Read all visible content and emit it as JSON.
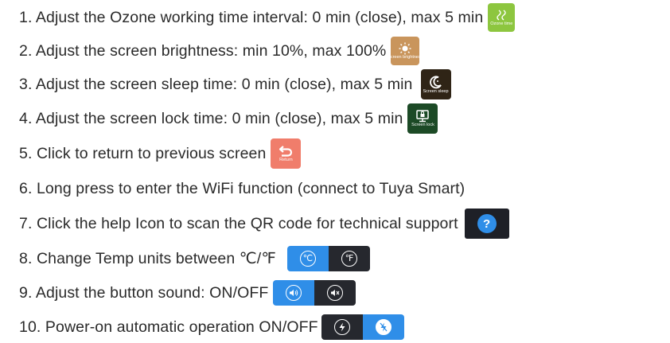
{
  "items": [
    {
      "text": "1. Adjust the Ozone working time interval: 0 min (close), max 5 min",
      "icon_label": "Ozone time"
    },
    {
      "text": "2. Adjust the screen brightness: min 10%, max 100%",
      "icon_label": "Screen brightness"
    },
    {
      "text": "3. Adjust the screen sleep time:  0 min (close), max 5 min",
      "icon_label": "Screen sleep"
    },
    {
      "text": "4. Adjust the screen lock time: 0 min (close), max 5 min",
      "icon_label": "Screen lock"
    },
    {
      "text": "5. Click  to return to previous screen",
      "icon_label": "Return"
    },
    {
      "text": "6. Long press to enter the WiFi function (connect to Tuya Smart)"
    },
    {
      "text": "7. Click the help Icon to scan the QR code for technical support",
      "icon_glyph": "?"
    },
    {
      "text": "8. Change Temp units between ℃/℉",
      "icon_left": "℃",
      "icon_right": "℉"
    },
    {
      "text": "9. Adjust the button sound: ON/OFF",
      "icon_left": "🔊",
      "icon_right": "🔇"
    },
    {
      "text": "10. Power-on automatic operation ON/OFF",
      "icon_left": "⚡",
      "icon_right": "✱"
    }
  ],
  "colors": {
    "ozone": "#8dc63f",
    "brightness": "#c9955c",
    "sleep": "#2f2416",
    "lock": "#1c4a26",
    "return": "#f07d6b",
    "blue": "#2f8ee8",
    "dark": "#26282e"
  },
  "icons": [
    "ozone-time-icon",
    "screen-brightness-icon",
    "screen-sleep-icon",
    "screen-lock-icon",
    "return-icon",
    "help-icon",
    "temp-unit-toggle",
    "sound-toggle",
    "auto-run-toggle"
  ]
}
